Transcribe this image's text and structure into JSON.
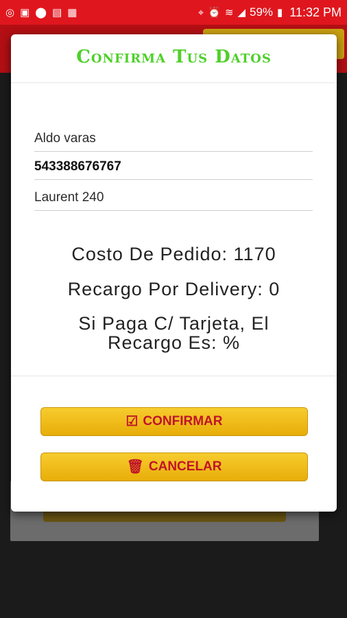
{
  "status_bar": {
    "battery": "59%",
    "time": "11:32 PM",
    "icons_left": [
      "instagram-icon",
      "image-icon",
      "news-icon",
      "gallery-icon",
      "notes-icon"
    ],
    "icons_right": [
      "location-icon",
      "alarm-icon",
      "wifi-icon",
      "signal-icon",
      "battery-icon"
    ]
  },
  "dialog": {
    "title": "Confirma Tus Datos",
    "fields": {
      "name": "Aldo varas",
      "phone": "543388676767",
      "address": "Laurent 240"
    },
    "info": {
      "cost": "Costo De Pedido: 1170",
      "delivery": "Recargo Por Delivery: 0",
      "card_line1": "Si Paga C/ Tarjeta, El",
      "card_line2": "Recargo Es: %"
    },
    "buttons": {
      "confirm": "CONFIRMAR",
      "cancel": "CANCELAR"
    }
  },
  "colors": {
    "status_bar": "#e0161e",
    "title": "#4fd02a",
    "button_bg": "#f2bf1e",
    "button_text": "#c0142a"
  }
}
